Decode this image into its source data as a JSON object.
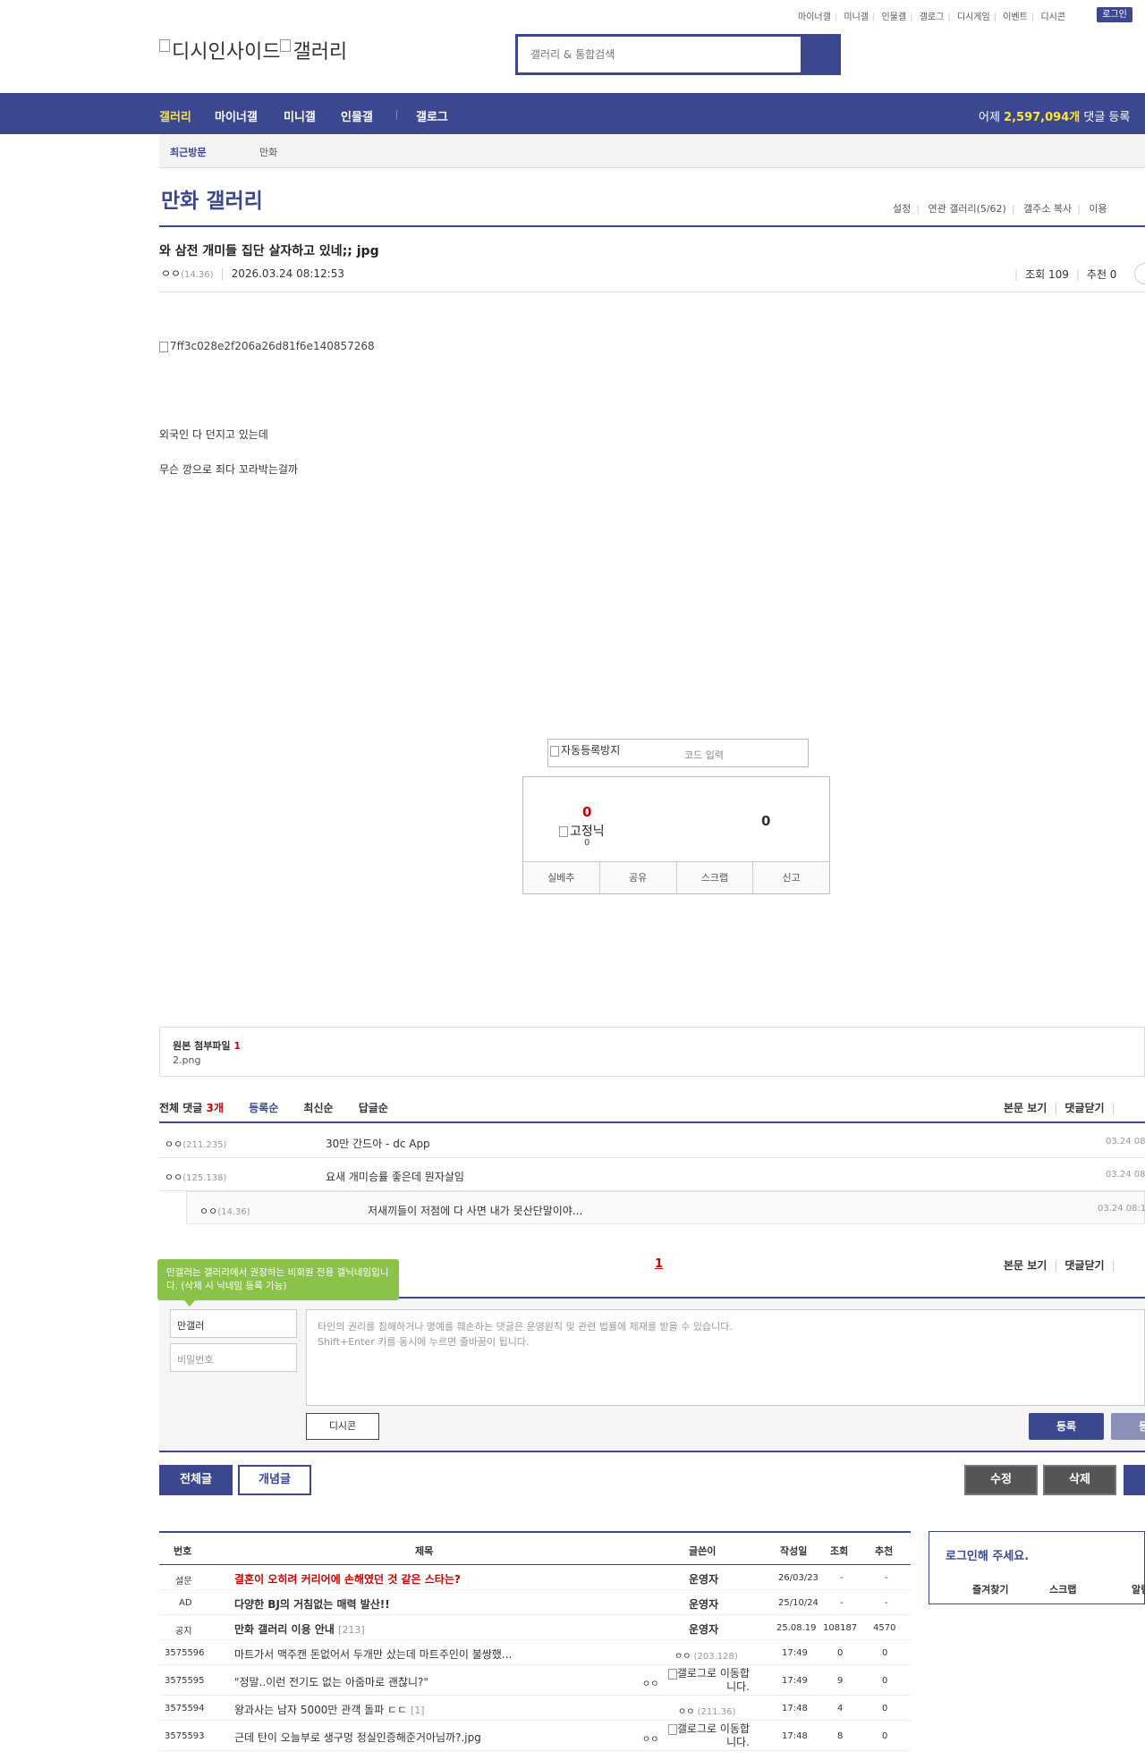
{
  "top_links": [
    "마이너갤",
    "미니갤",
    "인물갤",
    "갤로그",
    "디시게임",
    "이벤트",
    "디시콘"
  ],
  "login_label": "로그인",
  "logo_alt": "디시인사이드",
  "logo_alt2": "갤러리",
  "search_placeholder": "갤러리 & 통합검색",
  "nav": {
    "items": [
      "갤러리",
      "마이너갤",
      "미니갤",
      "인물갤",
      "갤로그"
    ],
    "yesterday_prefix": "어제",
    "yesterday_count": "2,597,094개",
    "yesterday_suffix": "댓글 등록"
  },
  "recent": {
    "label": "최근방문",
    "item": "만화"
  },
  "gallery": {
    "title": "만화 갤러리",
    "menu": [
      "설정",
      "연관 갤러리(5/62)",
      "갤주소 복사",
      "이용"
    ]
  },
  "post": {
    "title": "와 삼전 개미들 집단 살자하고 있네;; jpg",
    "author": "ㅇㅇ",
    "author_ip": "(14.36)",
    "datetime": "2026.03.24 08:12:53",
    "views_label": "조회 109",
    "recommend_label": "추천 0",
    "image_alt": "7ff3c028e2f206a26d81f6e140857268",
    "body": [
      "외국인 다 던지고 있는데",
      "무슨 깡으로 죄다 꼬라박는걸까"
    ]
  },
  "captcha": {
    "alt": "자동등록방지",
    "placeholder": "코드 입력"
  },
  "recommend": {
    "up": "0",
    "fixed_alt": "고정닉",
    "fixed_count": "0",
    "down": "0",
    "buttons": [
      "실베추",
      "공유",
      "스크랩",
      "신고"
    ]
  },
  "attachment": {
    "label": "원본 첨부파일",
    "count": "1",
    "file": "2.png"
  },
  "comments": {
    "total_prefix": "전체 댓글",
    "total_count": "3개",
    "tabs": [
      "등록순",
      "최신순",
      "답글순"
    ],
    "right_links": [
      "본문 보기",
      "댓글닫기"
    ],
    "items": [
      {
        "nick": "ㅇㅇ",
        "ip": "(211.235)",
        "text": "30만 간드아 - dc App",
        "date": "03.24 08"
      },
      {
        "nick": "ㅇㅇ",
        "ip": "(125.138)",
        "text": "요새 개미승률 좋은데 뭔자살임",
        "date": "03.24 08"
      },
      {
        "nick": "ㅇㅇ",
        "ip": "(14.36)",
        "text": "저새끼들이 저점에 다 사면 내가 못산단말이야...",
        "date": "03.24 08:1"
      }
    ],
    "page": "1"
  },
  "write": {
    "tooltip": "만갤러는 갤러리에서 권장하는 비회원 전용 갤닉네임입니다. (삭제 시 닉네임 등록 가능)",
    "nick_value": "만갤러",
    "password_placeholder": "비밀번호",
    "text_placeholder_1": "타인의 권리를 침해하거나 명예를 훼손하는 댓글은 운영원칙 및 관련 법률에 제재를 받을 수 있습니다.",
    "text_placeholder_2": "Shift+Enter 키를 동시에 누르면 줄바꿈이 됩니다.",
    "dccon": "디시콘",
    "submit": "등록",
    "submit2": "등록"
  },
  "list_buttons": {
    "all": "전체글",
    "concept": "개념글",
    "edit": "수정",
    "delete": "삭제"
  },
  "list": {
    "headers": [
      "번호",
      "제목",
      "글쓴이",
      "작성일",
      "조회",
      "추천"
    ],
    "rows": [
      {
        "no": "설문",
        "title": "결혼이 오히려 커리어에 손해였던 것 같은 스타는?",
        "writer": "운영자",
        "date": "26/03/23",
        "views": "-",
        "rec": "-",
        "style": "red"
      },
      {
        "no": "AD",
        "title": "다양한 BJ의 거침없는 매력 발산!!",
        "writer": "운영자",
        "date": "25/10/24",
        "views": "-",
        "rec": "-",
        "style": "bold"
      },
      {
        "no": "공지",
        "title": "만화 갤러리 이용 안내",
        "reply": "[213]",
        "writer": "운영자",
        "date": "25.08.19",
        "views": "108187",
        "rec": "4570",
        "style": "bold"
      },
      {
        "no": "3575596",
        "title": "마트가서 맥주캔 돈없어서 두개만 샀는데 마트주인이 불쌍했...",
        "writer_nick": "ㅇㅇ",
        "writer_ip": "(203.128)",
        "date": "17:49",
        "views": "0",
        "rec": "0"
      },
      {
        "no": "3575595",
        "title": "\"정말..이런 전기도 없는 아줌마로 괜찮니?\"",
        "writer_nick": "ㅇㅇ",
        "writer_alt": "갤로그로 이동합니다.",
        "date": "17:49",
        "views": "9",
        "rec": "0"
      },
      {
        "no": "3575594",
        "title": "왕과사는 남자 5000만 관객 돌파 ㄷㄷ",
        "reply": "[1]",
        "writer_nick": "ㅇㅇ",
        "writer_ip": "(211.36)",
        "date": "17:48",
        "views": "4",
        "rec": "0"
      },
      {
        "no": "3575593",
        "title": "근데 탄이 오늘부로 생구멍 정실인증해준거아님까?.jpg",
        "writer_nick": "ㅇㅇ",
        "writer_alt": "갤로그로 이동합니다.",
        "date": "17:48",
        "views": "8",
        "rec": "0"
      }
    ]
  },
  "login_box": {
    "title": "로그인해 주세요.",
    "links": [
      "즐겨찾기",
      "스크랩",
      "알림"
    ]
  }
}
